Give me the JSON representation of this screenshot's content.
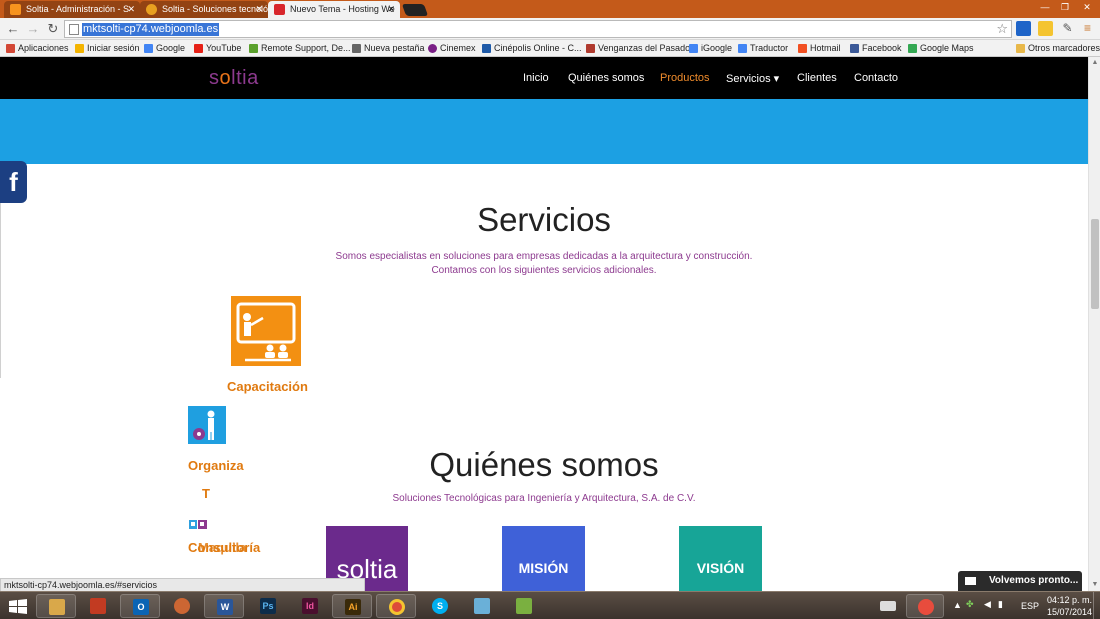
{
  "browser": {
    "tabs": [
      {
        "title": "Soltia - Administración - S",
        "active": false
      },
      {
        "title": "Soltia - Soluciones tecnoló",
        "active": false
      },
      {
        "title": "Nuevo Tema - Hosting We",
        "active": true
      }
    ],
    "url": "mktsolti-cp74.webjoomla.es",
    "status_url": "mktsolti-cp74.webjoomla.es/#servicios"
  },
  "bookmarks": [
    {
      "label": "Aplicaciones",
      "color": "#d34836"
    },
    {
      "label": "Iniciar sesión",
      "color": "#f4b400"
    },
    {
      "label": "Google",
      "color": "#4285f4"
    },
    {
      "label": "YouTube",
      "color": "#e62117"
    },
    {
      "label": "Remote Support, De...",
      "color": "#5aa02c"
    },
    {
      "label": "Nueva pestaña",
      "color": "#666666"
    },
    {
      "label": "Cinemex",
      "color": "#7a1f86"
    },
    {
      "label": "Cinépolis Online - C...",
      "color": "#1e5aa8"
    },
    {
      "label": "Venganzas del Pasado",
      "color": "#b03a2e"
    },
    {
      "label": "iGoogle",
      "color": "#4285f4"
    },
    {
      "label": "Traductor",
      "color": "#4285f4"
    },
    {
      "label": "Hotmail",
      "color": "#f25022"
    },
    {
      "label": "Facebook",
      "color": "#3b5998"
    },
    {
      "label": "Google Maps",
      "color": "#34a853"
    },
    {
      "label": "Otros marcadores",
      "color": "#e8b84a"
    }
  ],
  "site": {
    "logo": {
      "pre": "s",
      "o": "o",
      "post": "ltia"
    },
    "nav": [
      {
        "label": "Inicio",
        "active": false
      },
      {
        "label": "Quiénes somos",
        "active": false
      },
      {
        "label": "Productos",
        "active": true
      },
      {
        "label": "Servicios ▾",
        "active": false
      },
      {
        "label": "Clientes",
        "active": false
      },
      {
        "label": "Contacto",
        "active": false
      }
    ],
    "colors": {
      "accent": "#e07a10",
      "purple": "#8d3a8f",
      "hero": "#1ca0e3"
    },
    "servicios": {
      "title": "Servicios",
      "subtitle_1": "Somos especialistas en soluciones para empresas dedicadas a la arquitectura y construcción.",
      "subtitle_2": "Contamos con los siguientes servicios adicionales.",
      "items": [
        {
          "label": "Capacitación",
          "icon": "training-presentation-icon"
        },
        {
          "label": "Organiza",
          "icon": "person-organize-icon"
        },
        {
          "label": "T",
          "icon": ""
        },
        {
          "label": "Consultoría",
          "icon": "consulting-icon"
        },
        {
          "label": "Maquila",
          "icon": ""
        }
      ]
    },
    "quienes": {
      "title": "Quiénes somos",
      "subtitle": "Soluciones Tecnológicas para Ingeniería y Arquitectura, S.A. de C.V.",
      "blocks": [
        {
          "label": "soltia",
          "color": "#6b2a8c"
        },
        {
          "label": "MISIÓN",
          "color": "#3f61d8"
        },
        {
          "label": "VISIÓN",
          "color": "#17a597"
        }
      ]
    },
    "chat_label": "Volvemos pronto..."
  },
  "taskbar": {
    "apps": [
      {
        "name": "explorer",
        "label": "",
        "color": "#d9a84a"
      },
      {
        "name": "metro",
        "label": "",
        "color": "#c23b22"
      },
      {
        "name": "outlook",
        "label": "O",
        "color": "#0a64b4"
      },
      {
        "name": "paint",
        "label": "",
        "color": "#cc6633"
      },
      {
        "name": "word",
        "label": "W",
        "color": "#2a5699"
      },
      {
        "name": "photoshop",
        "label": "Ps",
        "color": "#0d2c4a"
      },
      {
        "name": "indesign",
        "label": "Id",
        "color": "#4a0f2e"
      },
      {
        "name": "illustrator",
        "label": "Ai",
        "color": "#3a2a0a"
      },
      {
        "name": "chrome",
        "label": "",
        "color": "#dd4b39"
      },
      {
        "name": "skype",
        "label": "S",
        "color": "#00aff0"
      },
      {
        "name": "notes",
        "label": "",
        "color": "#6ab0d8"
      },
      {
        "name": "chart",
        "label": "",
        "color": "#7ab040"
      }
    ],
    "lang": "ESP",
    "time": "04:12 p. m.",
    "date": "15/07/2014"
  }
}
